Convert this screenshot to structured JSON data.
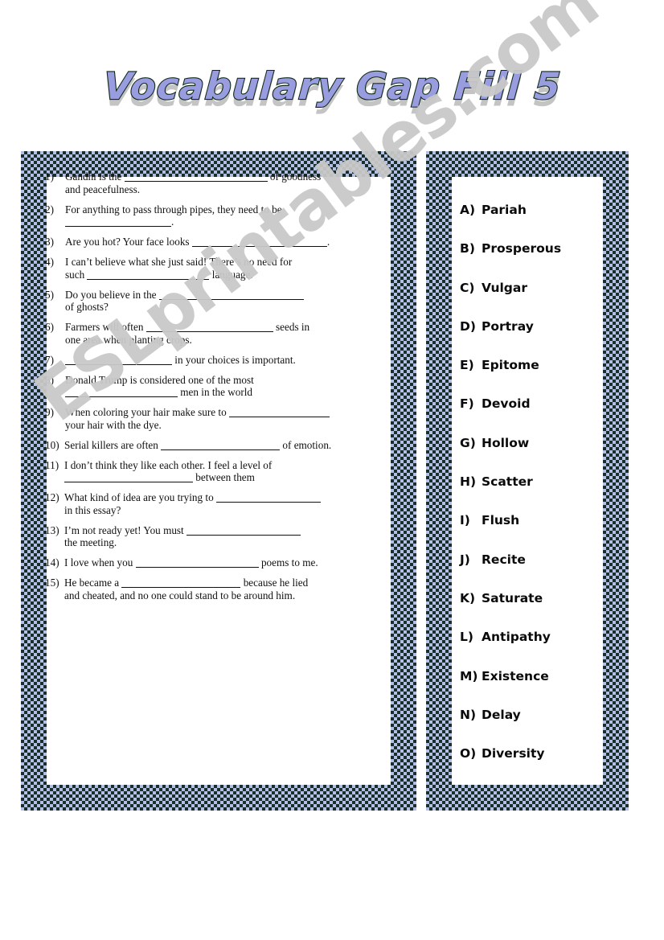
{
  "title": "Vocabulary Gap Fill 5",
  "watermark": "ESLprintables.com",
  "colors": {
    "title_fill": "#9a9ce0",
    "title_outline": "#0d2b18",
    "border_light": "#b6bee6",
    "border_dark": "#17302c",
    "page_bg": "#ffffff",
    "text": "#101010",
    "watermark": "#c9c9c9"
  },
  "questions": [
    {
      "num": "1)",
      "lines": [
        [
          {
            "t": "text",
            "v": "Gandhi is the "
          },
          {
            "t": "blank",
            "w": 178
          },
          {
            "t": "text",
            "v": " of goodness"
          }
        ],
        [
          {
            "t": "text",
            "v": "and peacefulness."
          }
        ]
      ]
    },
    {
      "num": "2)",
      "lines": [
        [
          {
            "t": "text",
            "v": "For anything to pass through pipes, they need to be"
          }
        ],
        [
          {
            "t": "blank",
            "w": 132
          },
          {
            "t": "text",
            "v": "."
          }
        ]
      ]
    },
    {
      "num": "3)",
      "lines": [
        [
          {
            "t": "text",
            "v": "Are you hot? Your face looks "
          },
          {
            "t": "blank",
            "w": 168
          },
          {
            "t": "text",
            "v": "."
          }
        ]
      ]
    },
    {
      "num": "4)",
      "lines": [
        [
          {
            "t": "text",
            "v": "I can’t believe what she just said! There’s no need for"
          }
        ],
        [
          {
            "t": "text",
            "v": "such "
          },
          {
            "t": "blank",
            "w": 152
          },
          {
            "t": "text",
            "v": " language."
          }
        ]
      ]
    },
    {
      "num": "5)",
      "lines": [
        [
          {
            "t": "text",
            "v": "Do you believe in the "
          },
          {
            "t": "blank",
            "w": 180
          }
        ],
        [
          {
            "t": "text",
            "v": "of ghosts?"
          }
        ]
      ]
    },
    {
      "num": "6)",
      "lines": [
        [
          {
            "t": "text",
            "v": "Farmers will often "
          },
          {
            "t": "blank",
            "w": 158
          },
          {
            "t": "text",
            "v": " seeds in"
          }
        ],
        [
          {
            "t": "text",
            "v": "one area when planting crops."
          }
        ]
      ]
    },
    {
      "num": "7)",
      "lines": [
        [
          {
            "t": "blank",
            "w": 133
          },
          {
            "t": "text",
            "v": " in your choices is important."
          }
        ]
      ]
    },
    {
      "num": "8)",
      "lines": [
        [
          {
            "t": "text",
            "v": "Donald Trump is considered one of the most"
          }
        ],
        [
          {
            "t": "blank",
            "w": 140
          },
          {
            "t": "text",
            "v": " men in the world"
          }
        ]
      ]
    },
    {
      "num": "9)",
      "lines": [
        [
          {
            "t": "text",
            "v": "When coloring your hair make sure to "
          },
          {
            "t": "blank",
            "w": 125
          }
        ],
        [
          {
            "t": "text",
            "v": "your hair with the dye."
          }
        ]
      ]
    },
    {
      "num": "10)",
      "lines": [
        [
          {
            "t": "text",
            "v": "Serial killers are often "
          },
          {
            "t": "blank",
            "w": 148
          },
          {
            "t": "text",
            "v": " of emotion."
          }
        ]
      ]
    },
    {
      "num": "11)",
      "lines": [
        [
          {
            "t": "text",
            "v": "I don’t think they like each other. I feel a level of"
          }
        ],
        [
          {
            "t": "blank",
            "w": 160
          },
          {
            "t": "text",
            "v": " between them"
          }
        ]
      ]
    },
    {
      "num": "12)",
      "lines": [
        [
          {
            "t": "text",
            "v": "What kind of idea are you trying to "
          },
          {
            "t": "blank",
            "w": 130
          }
        ],
        [
          {
            "t": "text",
            "v": "in this essay?"
          }
        ]
      ]
    },
    {
      "num": "13)",
      "lines": [
        [
          {
            "t": "text",
            "v": "I’m not ready yet! You must "
          },
          {
            "t": "blank",
            "w": 142
          }
        ],
        [
          {
            "t": "text",
            "v": "the meeting."
          }
        ]
      ]
    },
    {
      "num": "14)",
      "lines": [
        [
          {
            "t": "text",
            "v": "I love when you "
          },
          {
            "t": "blank",
            "w": 153
          },
          {
            "t": "text",
            "v": " poems to me."
          }
        ]
      ]
    },
    {
      "num": "15)",
      "lines": [
        [
          {
            "t": "text",
            "v": "He became a "
          },
          {
            "t": "blank",
            "w": 148
          },
          {
            "t": "text",
            "v": " because he lied"
          }
        ],
        [
          {
            "t": "text",
            "v": "and cheated, and no one could stand to be around him."
          }
        ]
      ]
    }
  ],
  "word_bank": [
    {
      "letter": "A)",
      "word": "Pariah"
    },
    {
      "letter": "B)",
      "word": "Prosperous"
    },
    {
      "letter": "C)",
      "word": "Vulgar"
    },
    {
      "letter": "D)",
      "word": "Portray"
    },
    {
      "letter": "E)",
      "word": "Epitome"
    },
    {
      "letter": "F)",
      "word": "Devoid"
    },
    {
      "letter": "G)",
      "word": "Hollow"
    },
    {
      "letter": "H)",
      "word": "Scatter"
    },
    {
      "letter": "I)",
      "word": "Flush"
    },
    {
      "letter": "J)",
      "word": "Recite"
    },
    {
      "letter": "K)",
      "word": "Saturate"
    },
    {
      "letter": "L)",
      "word": "Antipathy"
    },
    {
      "letter": "M)",
      "word": "Existence"
    },
    {
      "letter": "N)",
      "word": "Delay"
    },
    {
      "letter": "O)",
      "word": "Diversity"
    }
  ]
}
